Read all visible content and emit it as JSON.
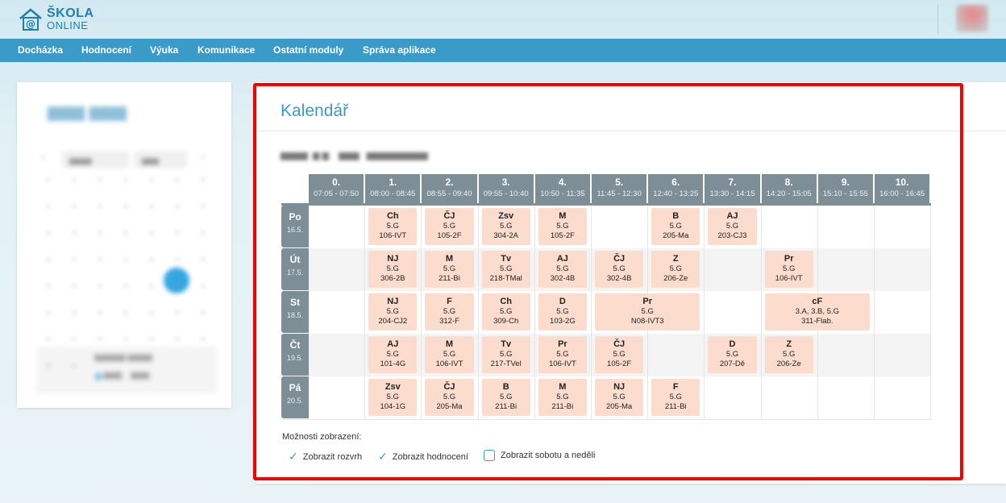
{
  "app": {
    "logo_line1": "ŠKOLA",
    "logo_line2": "ONLINE",
    "accent_color": "#3a9ac8"
  },
  "nav": {
    "items": [
      {
        "label": "Docházka"
      },
      {
        "label": "Hodnocení"
      },
      {
        "label": "Výuka"
      },
      {
        "label": "Komunikace"
      },
      {
        "label": "Ostatní moduly"
      },
      {
        "label": "Správa aplikace"
      }
    ]
  },
  "calendar": {
    "title": "Kalendář",
    "periods": [
      {
        "num": "0.",
        "time": "07:05 - 07:50"
      },
      {
        "num": "1.",
        "time": "08:00 - 08:45"
      },
      {
        "num": "2.",
        "time": "08:55 - 09:40"
      },
      {
        "num": "3.",
        "time": "09:55 - 10:40"
      },
      {
        "num": "4.",
        "time": "10:50 - 11:35"
      },
      {
        "num": "5.",
        "time": "11:45 - 12:30"
      },
      {
        "num": "6.",
        "time": "12:40 - 13:25"
      },
      {
        "num": "7.",
        "time": "13:30 - 14:15"
      },
      {
        "num": "8.",
        "time": "14:20 - 15:05"
      },
      {
        "num": "9.",
        "time": "15:10 - 15:55"
      },
      {
        "num": "10.",
        "time": "16:00 - 16:45"
      }
    ],
    "days": [
      {
        "name": "Po",
        "date": "16.5.",
        "lessons": [
          {
            "p": 1,
            "span": 1,
            "subject": "Ch",
            "class": "5.G",
            "room": "106-IVT"
          },
          {
            "p": 2,
            "span": 1,
            "subject": "ČJ",
            "class": "5.G",
            "room": "105-2F"
          },
          {
            "p": 3,
            "span": 1,
            "subject": "Zsv",
            "class": "5.G",
            "room": "304-2A"
          },
          {
            "p": 4,
            "span": 1,
            "subject": "M",
            "class": "5.G",
            "room": "105-2F"
          },
          {
            "p": 6,
            "span": 1,
            "subject": "B",
            "class": "5.G",
            "room": "205-Ma"
          },
          {
            "p": 7,
            "span": 1,
            "subject": "AJ",
            "class": "5.G",
            "room": "203-CJ3"
          }
        ]
      },
      {
        "name": "Út",
        "date": "17.5.",
        "lessons": [
          {
            "p": 1,
            "span": 1,
            "subject": "NJ",
            "class": "5.G",
            "room": "306-2B"
          },
          {
            "p": 2,
            "span": 1,
            "subject": "M",
            "class": "5.G",
            "room": "211-Bi"
          },
          {
            "p": 3,
            "span": 1,
            "subject": "Tv",
            "class": "5.G",
            "room": "218-TMal"
          },
          {
            "p": 4,
            "span": 1,
            "subject": "AJ",
            "class": "5.G",
            "room": "302-4B"
          },
          {
            "p": 5,
            "span": 1,
            "subject": "ČJ",
            "class": "5.G",
            "room": "302-4B"
          },
          {
            "p": 6,
            "span": 1,
            "subject": "Z",
            "class": "5.G",
            "room": "206-Ze"
          },
          {
            "p": 8,
            "span": 1,
            "subject": "Pr",
            "class": "5.G",
            "room": "106-IVT"
          }
        ]
      },
      {
        "name": "St",
        "date": "18.5.",
        "lessons": [
          {
            "p": 1,
            "span": 1,
            "subject": "NJ",
            "class": "5.G",
            "room": "204-CJ2"
          },
          {
            "p": 2,
            "span": 1,
            "subject": "F",
            "class": "5.G",
            "room": "312-F"
          },
          {
            "p": 3,
            "span": 1,
            "subject": "Ch",
            "class": "5.G",
            "room": "309-Ch"
          },
          {
            "p": 4,
            "span": 1,
            "subject": "D",
            "class": "5.G",
            "room": "103-2G"
          },
          {
            "p": 5,
            "span": 2,
            "subject": "Pr",
            "class": "5.G",
            "room": "N08-IVT3"
          },
          {
            "p": 8,
            "span": 2,
            "subject": "cF",
            "class": "3.A, 3.B, 5.G",
            "room": "311-Flab."
          }
        ]
      },
      {
        "name": "Čt",
        "date": "19.5.",
        "lessons": [
          {
            "p": 1,
            "span": 1,
            "subject": "AJ",
            "class": "5.G",
            "room": "101-4G"
          },
          {
            "p": 2,
            "span": 1,
            "subject": "M",
            "class": "5.G",
            "room": "106-IVT"
          },
          {
            "p": 3,
            "span": 1,
            "subject": "Tv",
            "class": "5.G",
            "room": "217-TVel"
          },
          {
            "p": 4,
            "span": 1,
            "subject": "Pr",
            "class": "5.G",
            "room": "106-IVT"
          },
          {
            "p": 5,
            "span": 1,
            "subject": "ČJ",
            "class": "5.G",
            "room": "105-2F"
          },
          {
            "p": 7,
            "span": 1,
            "subject": "D",
            "class": "5.G",
            "room": "207-Dě"
          },
          {
            "p": 8,
            "span": 1,
            "subject": "Z",
            "class": "5.G",
            "room": "206-Ze"
          }
        ]
      },
      {
        "name": "Pá",
        "date": "20.5.",
        "lessons": [
          {
            "p": 1,
            "span": 1,
            "subject": "Zsv",
            "class": "5.G",
            "room": "104-1G"
          },
          {
            "p": 2,
            "span": 1,
            "subject": "ČJ",
            "class": "5.G",
            "room": "205-Ma"
          },
          {
            "p": 3,
            "span": 1,
            "subject": "B",
            "class": "5.G",
            "room": "211-Bi"
          },
          {
            "p": 4,
            "span": 1,
            "subject": "M",
            "class": "5.G",
            "room": "211-Bi"
          },
          {
            "p": 5,
            "span": 1,
            "subject": "NJ",
            "class": "5.G",
            "room": "205-Ma"
          },
          {
            "p": 6,
            "span": 1,
            "subject": "F",
            "class": "5.G",
            "room": "211-Bi"
          }
        ]
      }
    ],
    "display_options_label": "Možnosti zobrazení:",
    "options": [
      {
        "label": "Zobrazit rozvrh",
        "checked": true
      },
      {
        "label": "Zobrazit hodnocení",
        "checked": true
      },
      {
        "label": "Zobrazit sobotu a neděli",
        "checked": false
      }
    ]
  }
}
